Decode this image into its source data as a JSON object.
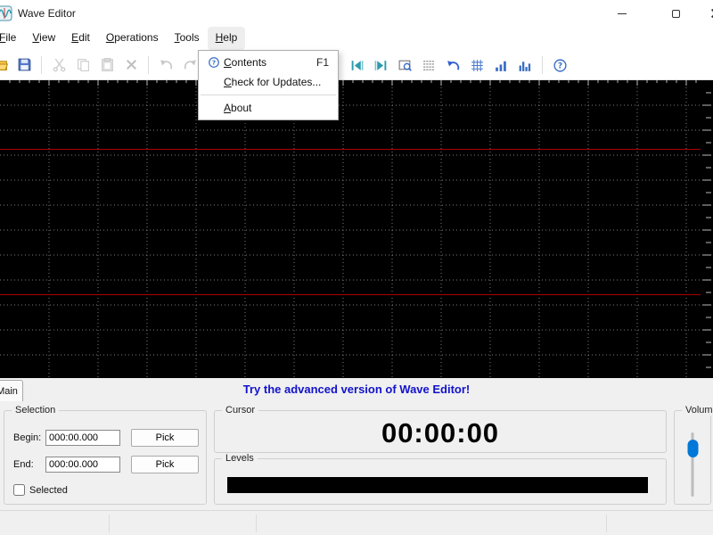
{
  "window": {
    "title": "Wave Editor",
    "controls": [
      "minimize-icon",
      "maximize-icon",
      "close-icon"
    ]
  },
  "menu": {
    "items": [
      "File",
      "View",
      "Edit",
      "Operations",
      "Tools",
      "Help"
    ]
  },
  "help_menu": {
    "items": [
      {
        "label": "Contents",
        "shortcut": "F1",
        "icon": "help-circle-icon"
      },
      {
        "label": "Check for Updates..."
      },
      {
        "label": "About"
      }
    ]
  },
  "toolbar": {
    "left_icons": [
      "open-folder-icon",
      "save-icon",
      "cut-icon",
      "copy-icon",
      "paste-icon",
      "delete-icon",
      "undo-icon",
      "redo-icon"
    ],
    "right_icons": [
      "skip-back-icon",
      "skip-forward-icon",
      "zoom-selection-icon",
      "spectrogram-icon",
      "revert-icon",
      "grid-icon",
      "statistics-icon",
      "histogram-icon",
      "help-icon"
    ]
  },
  "waveform": {
    "background": "#000000",
    "grid_color": "#9a9a9a",
    "center_line_color": "#aa0000",
    "tick_color": "#cfcfcf"
  },
  "tabbar": {
    "tab_label": "Main",
    "promo_text": "Try the advanced version of Wave Editor!",
    "promo_color": "#1212cc"
  },
  "selection": {
    "title": "Selection",
    "begin_label": "Begin:",
    "begin_value": "000:00.000",
    "end_label": "End:",
    "end_value": "000:00.000",
    "pick_label": "Pick",
    "selected_label": "Selected",
    "selected_checked": false
  },
  "cursor": {
    "title": "Cursor",
    "value": "00:00:00"
  },
  "levels": {
    "title": "Levels"
  },
  "volume": {
    "title": "Volume",
    "accent": "#0078d7"
  }
}
